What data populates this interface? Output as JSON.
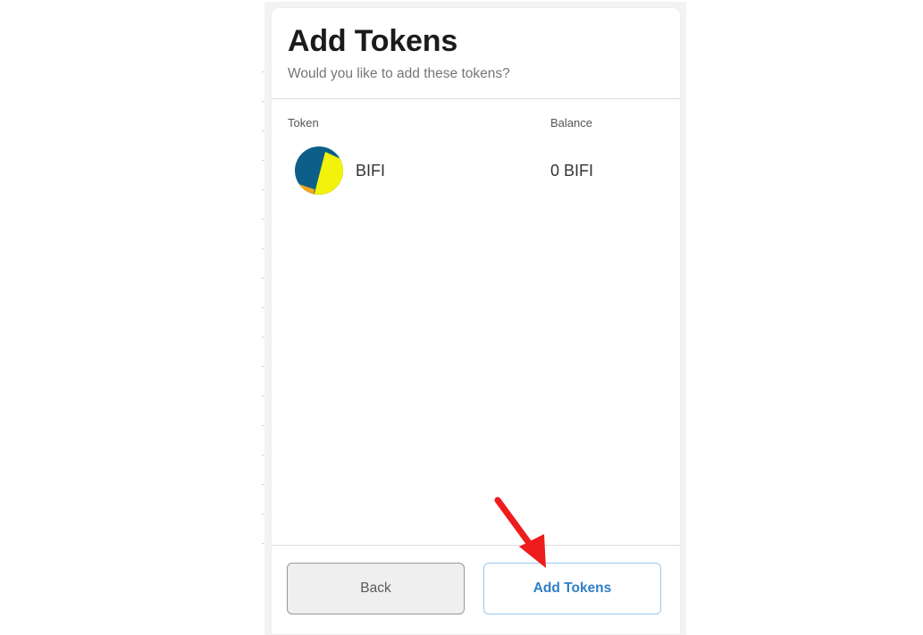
{
  "header": {
    "title": "Add Tokens",
    "subtitle": "Would you like to add these tokens?"
  },
  "table": {
    "columns": [
      "Token",
      "Balance"
    ],
    "rows": [
      {
        "symbol": "BIFI",
        "balance": "0 BIFI",
        "icon": "bifi-token-icon"
      }
    ]
  },
  "footer": {
    "back_label": "Back",
    "add_label": "Add Tokens"
  },
  "annotation": {
    "icon": "red-arrow-icon",
    "color": "#ee1c1c"
  },
  "colors": {
    "primary_blue": "#2f7fc6",
    "token_dark": "#0d5f8a",
    "token_yellow": "#f2f20a",
    "token_orange": "#f5a81c"
  }
}
